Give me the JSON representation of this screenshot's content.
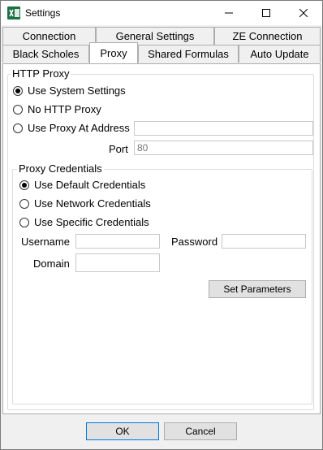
{
  "window": {
    "title": "Settings",
    "app_icon_letter": "X",
    "controls": [
      "minimize-icon",
      "maximize-icon",
      "close-icon"
    ]
  },
  "tabs": {
    "row_top": [
      {
        "label": "Connection"
      },
      {
        "label": "General Settings"
      },
      {
        "label": "ZE Connection"
      }
    ],
    "row_bottom": [
      {
        "label": "Black Scholes"
      },
      {
        "label": "Proxy",
        "active": true
      },
      {
        "label": "Shared Formulas"
      },
      {
        "label": "Auto Update"
      }
    ]
  },
  "http_proxy": {
    "title": "HTTP Proxy",
    "options": [
      {
        "label": "Use System Settings",
        "selected": true
      },
      {
        "label": "No HTTP Proxy",
        "selected": false
      },
      {
        "label": "Use Proxy At Address",
        "selected": false
      }
    ],
    "address_value": "",
    "port_label": "Port",
    "port_placeholder": "80"
  },
  "proxy_credentials": {
    "title": "Proxy Credentials",
    "options": [
      {
        "label": "Use Default Credentials",
        "selected": true
      },
      {
        "label": "Use Network Credentials",
        "selected": false
      },
      {
        "label": "Use Specific Credentials",
        "selected": false
      }
    ],
    "username_label": "Username",
    "password_label": "Password",
    "domain_label": "Domain",
    "set_parameters_label": "Set Parameters"
  },
  "footer": {
    "ok_label": "OK",
    "cancel_label": "Cancel"
  }
}
